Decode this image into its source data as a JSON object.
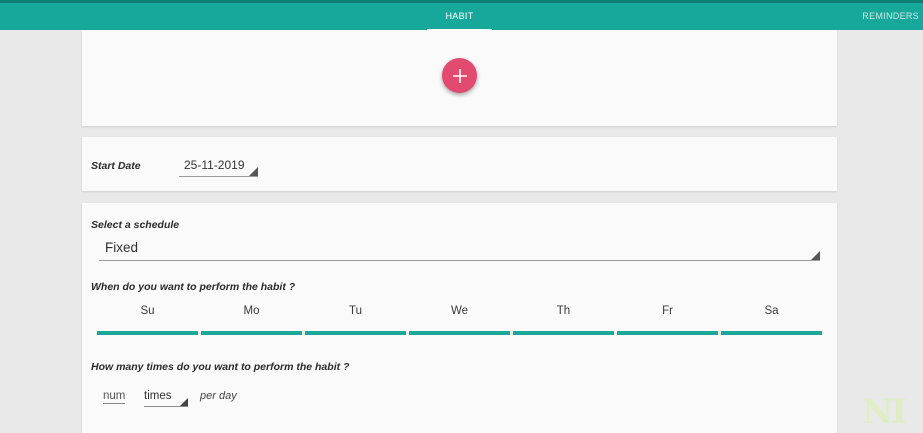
{
  "tabs": [
    {
      "label": "HABIT",
      "active": true
    },
    {
      "label": "REMINDERS",
      "active": false
    }
  ],
  "add_button": {
    "icon": "plus-icon"
  },
  "start_date": {
    "label": "Start Date",
    "value": "25-11-2019"
  },
  "schedule": {
    "label": "Select a schedule",
    "value": "Fixed",
    "when_label": "When do you want to perform the habit ?",
    "days": [
      "Su",
      "Mo",
      "Tu",
      "We",
      "Th",
      "Fr",
      "Sa"
    ],
    "how_many_label": "How many times do you want to perform the habit ?",
    "num_placeholder": "num",
    "times_value": "times",
    "per_day": "per day"
  },
  "colors": {
    "primary": "#16a89a",
    "accent": "#e24a6f",
    "background": "#e9e9e9"
  }
}
